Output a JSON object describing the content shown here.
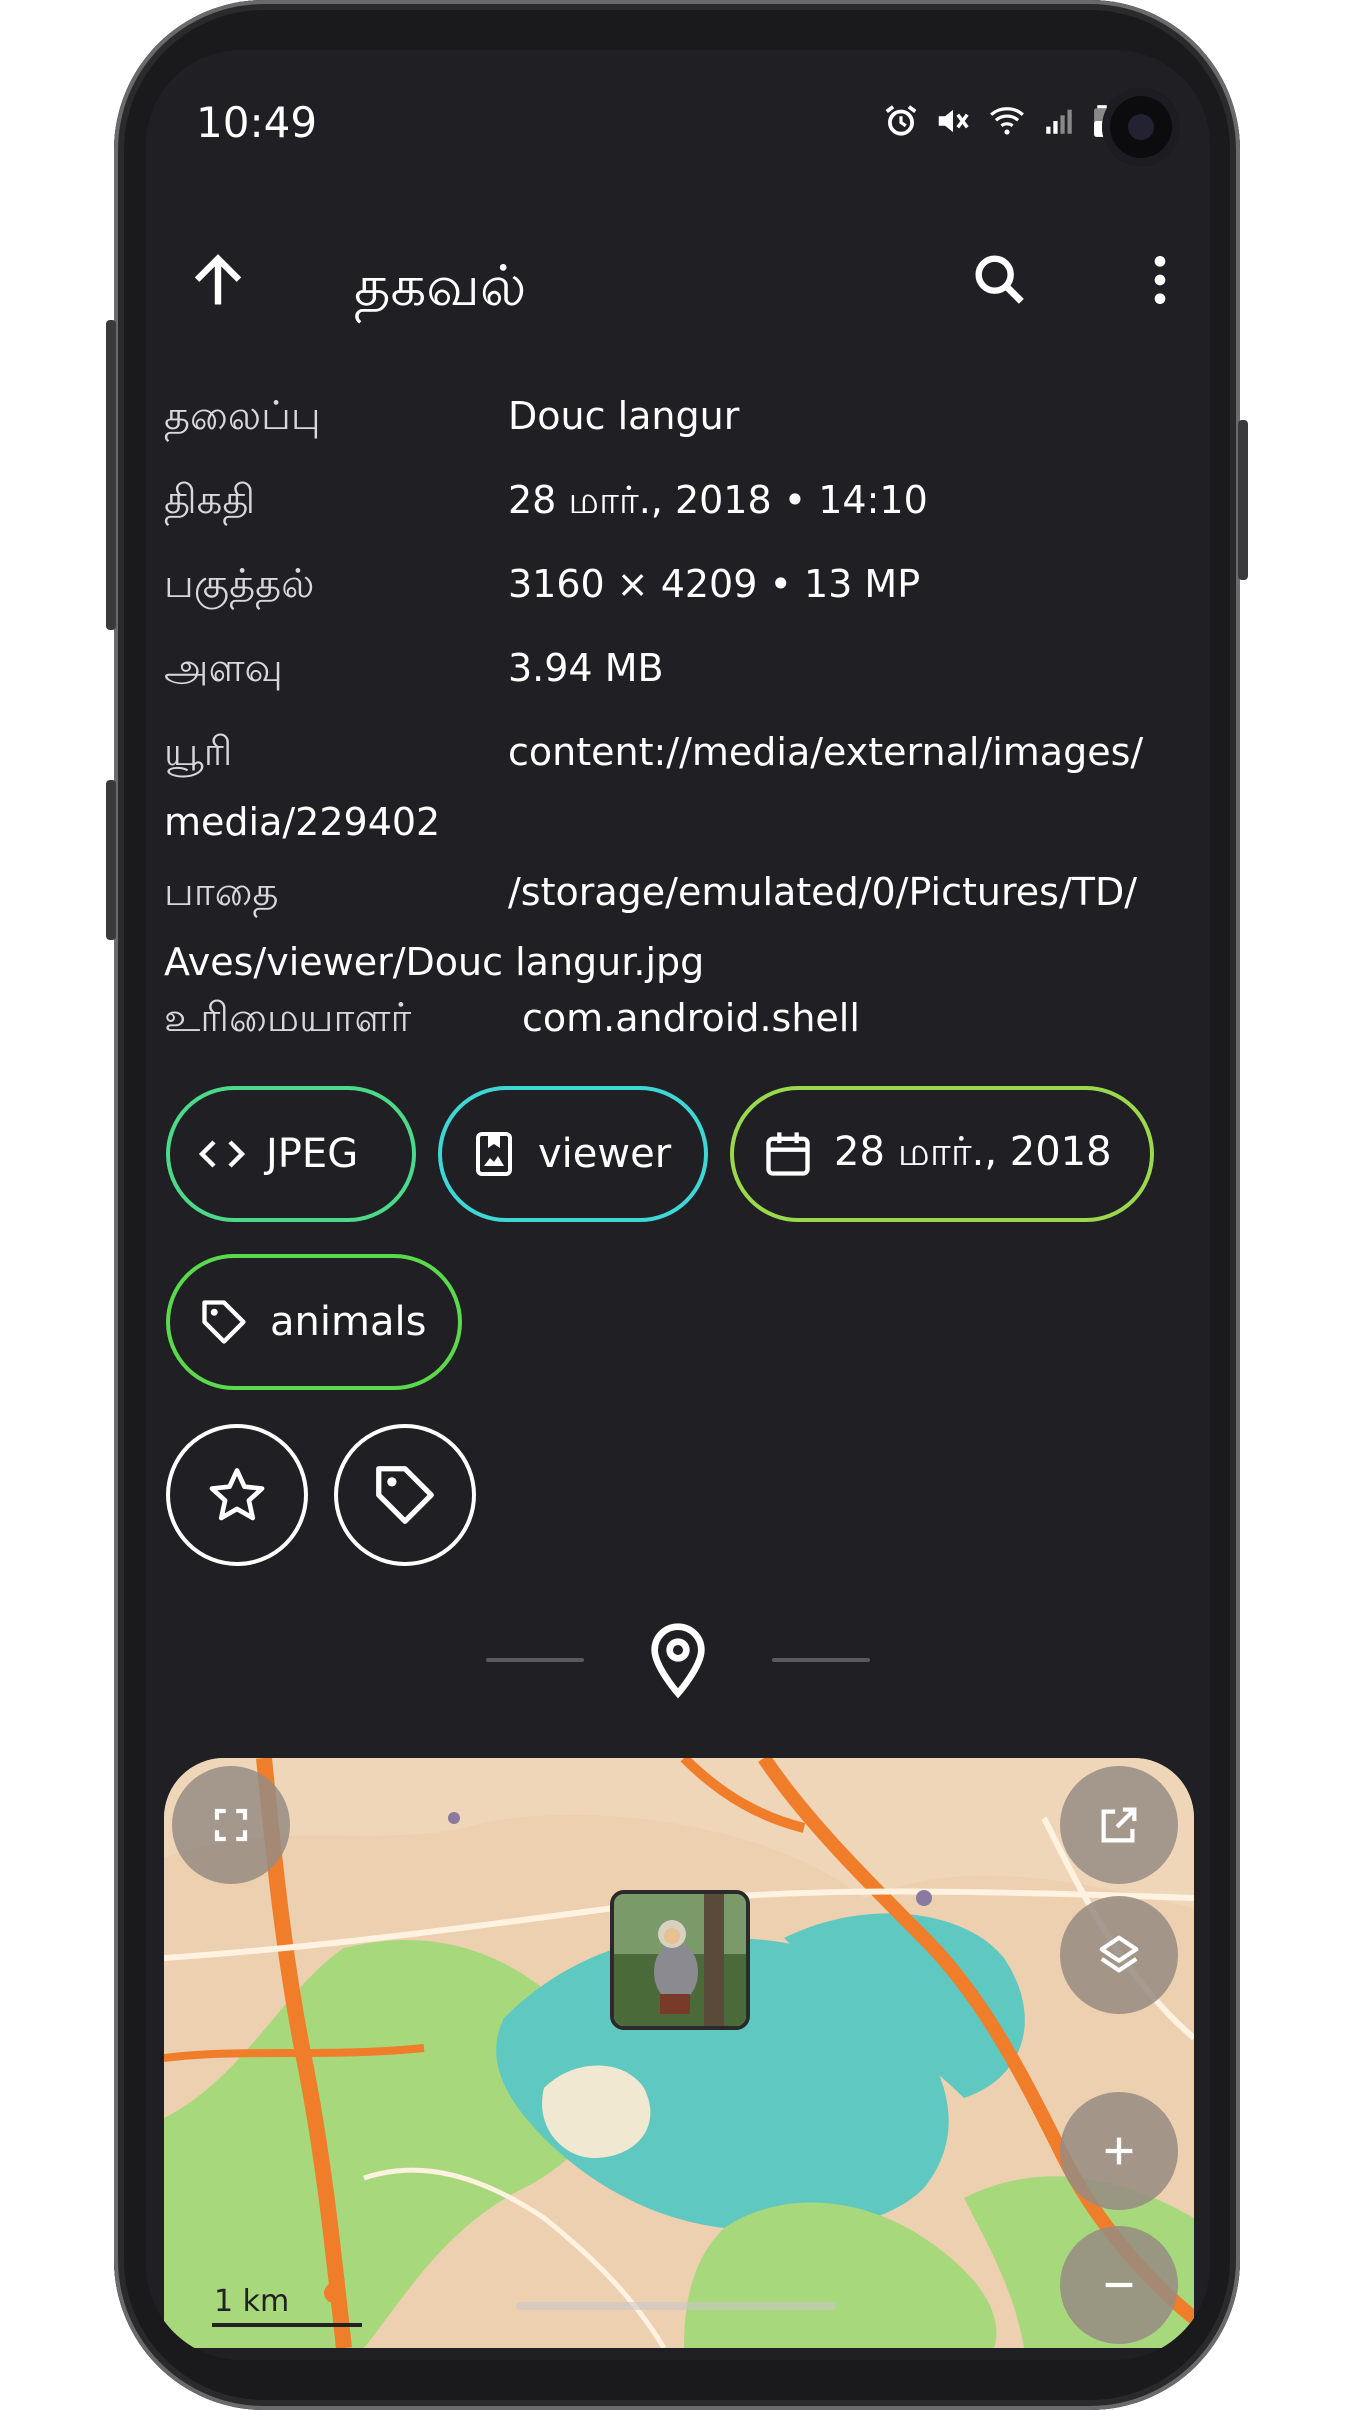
{
  "status_bar": {
    "time": "10:49"
  },
  "app_bar": {
    "title": "தகவல்"
  },
  "info": {
    "title_label": "தலைப்பு",
    "title_value": "Douc langur",
    "date_label": "திகதி",
    "date_value": "28 மார்., 2018 • 14:10",
    "resolution_label": "பகுத்தல்",
    "resolution_value": "3160 × 4209 • 13 MP",
    "size_label": "அளவு",
    "size_value": "3.94 MB",
    "uri_label": "யூரி",
    "uri_value_line1": "content://media/external/images/",
    "uri_value_line2": "media/229402",
    "path_label": "பாதை",
    "path_value_line1": "/storage/emulated/0/Pictures/TD/",
    "path_value_line2": "Aves/viewer/Douc langur.jpg",
    "owner_label": "உரிமையாளர்",
    "owner_value": "com.android.shell"
  },
  "chips": {
    "format": "JPEG",
    "album": "viewer",
    "date": "28 மார்., 2018",
    "tag": "animals"
  },
  "colors": {
    "format_chip": "#4cd98a",
    "album_chip": "#3fd6d6",
    "date_chip": "#9bd94c",
    "tag_chip": "#5ad94c"
  },
  "map": {
    "scale_label": "1 km"
  }
}
